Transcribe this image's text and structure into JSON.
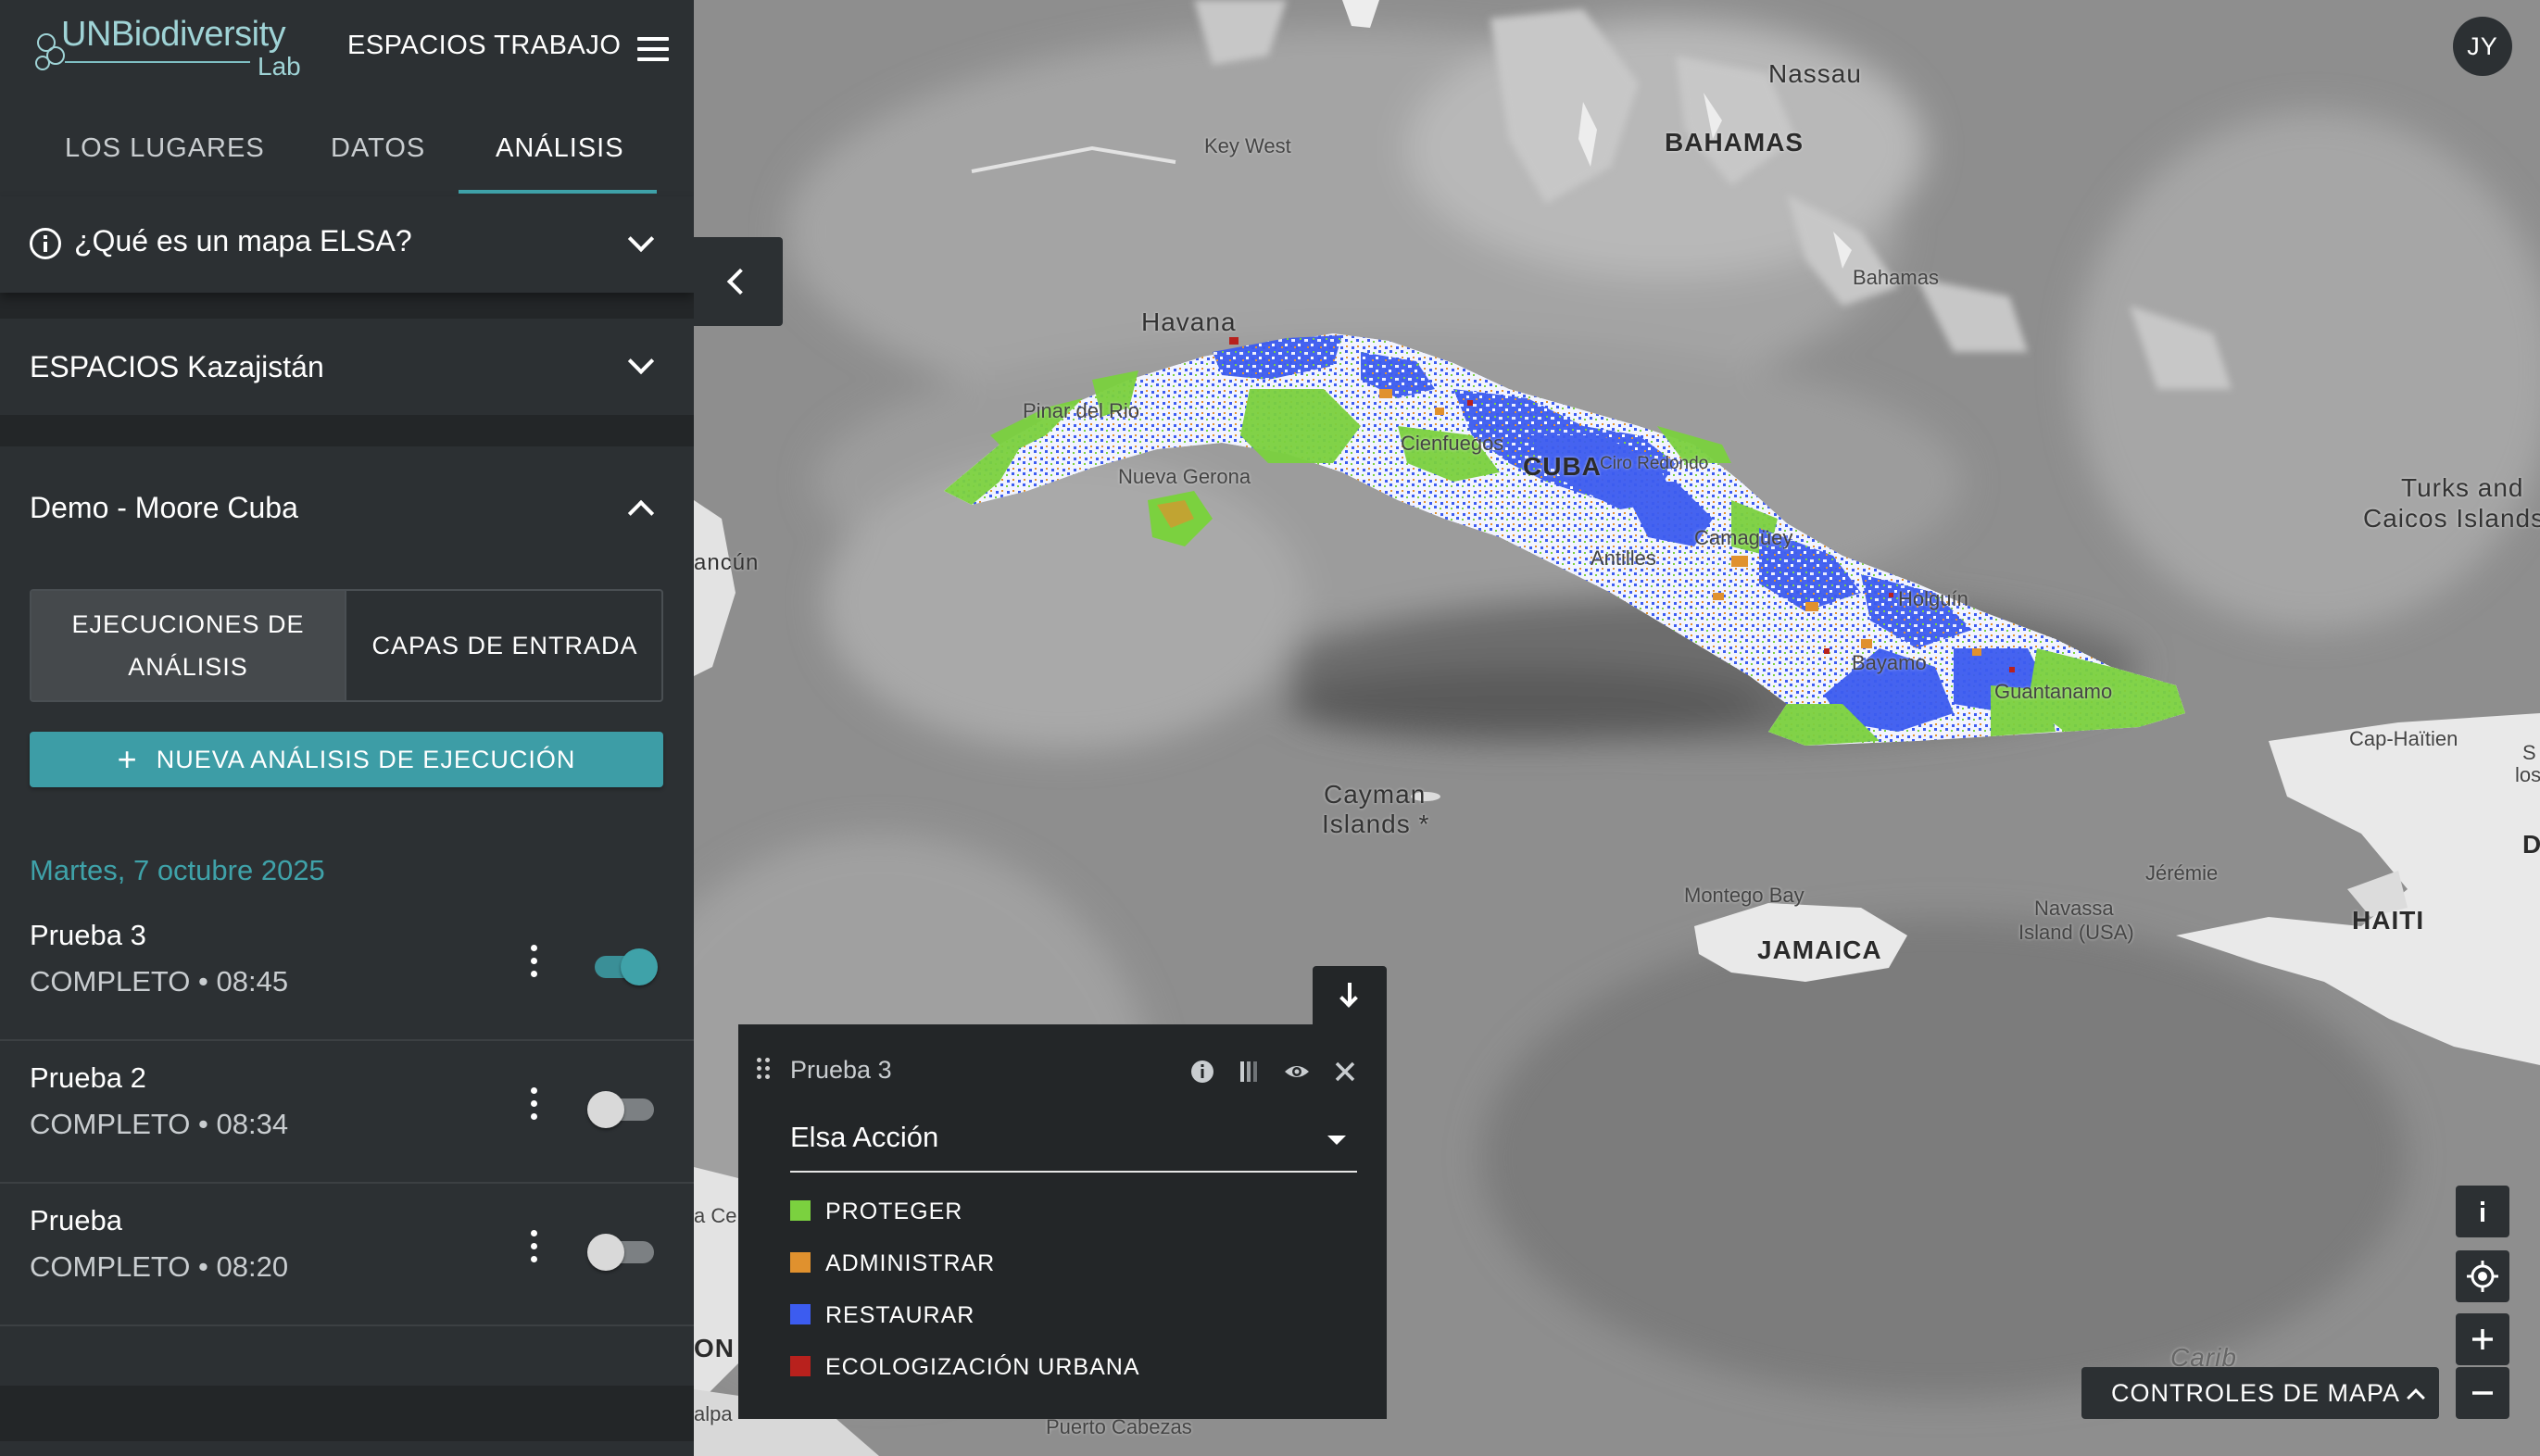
{
  "app": {
    "logo_main": "UNBiodiversity",
    "logo_sub": "Lab",
    "workspace_label": "ESPACIOS TRABAJO",
    "user_initials": "JY"
  },
  "tabs": [
    {
      "label": "LOS LUGARES",
      "active": false
    },
    {
      "label": "DATOS",
      "active": false
    },
    {
      "label": "ANÁLISIS",
      "active": true
    }
  ],
  "accordions": {
    "elsa_info": "¿Qué es un mapa ELSA?",
    "workspace": "ESPACIOS Kazajistán",
    "project": "Demo - Moore Cuba"
  },
  "segmented": {
    "runs_label": "EJECUCIONES DE ANÁLISIS",
    "inputs_label": "CAPAS DE ENTRADA"
  },
  "new_run_button": "NUEVA ANÁLISIS DE EJECUCIÓN",
  "date_heading": "Martes, 7 octubre 2025",
  "runs": [
    {
      "name": "Prueba 3",
      "status": "COMPLETO • 08:45",
      "enabled": true
    },
    {
      "name": "Prueba 2",
      "status": "COMPLETO • 08:34",
      "enabled": false
    },
    {
      "name": "Prueba",
      "status": "COMPLETO • 08:20",
      "enabled": false
    }
  ],
  "legend": {
    "title": "Prueba 3",
    "selected_layer": "Elsa Acción",
    "items": [
      {
        "label": "PROTEGER",
        "color": "#7bd13f"
      },
      {
        "label": "ADMINISTRAR",
        "color": "#e0912e"
      },
      {
        "label": "RESTAURAR",
        "color": "#3c5cf0"
      },
      {
        "label": "ECOLOGIZACIÓN URBANA",
        "color": "#b8211d"
      }
    ]
  },
  "map": {
    "controls_label": "CONTROLES DE MAPA",
    "places": {
      "nassau": "Nassau",
      "bahamas_country": "BAHAMAS",
      "key_west": "Key West",
      "havana": "Havana",
      "bahamas_island": "Bahamas",
      "turks": "Turks and",
      "caicos": "Caicos Islands",
      "pinar": "Pinar del Rio",
      "cienfuegos": "Cienfuegos",
      "cuba": "CUBA",
      "ciro": "Ciro Redondo",
      "nueva_gerona": "Nueva Gerona",
      "camaguey": "Camagüey",
      "antilles": "Antilles",
      "cancun": "ancún",
      "holguin": "Holguín",
      "bayamo": "Bayamo",
      "guantanamo": "Guantanamo",
      "cap_haitien": "Cap-Haïtien",
      "cayman1": "Cayman",
      "cayman2": "Islands *",
      "jeremie": "Jérémie",
      "montego": "Montego Bay",
      "jamaica": "JAMAICA",
      "navassa1": "Navassa",
      "navassa2": "Island (USA)",
      "haiti": "HAITI",
      "puerto_cabezas": "Puerto Cabezas",
      "caribbean": "Carib",
      "edge_s": "S",
      "edge_los": "los",
      "edge_d": "D",
      "edge_ace": "a Ce",
      "edge_on": "ON",
      "edge_alpa": "alpa"
    }
  }
}
